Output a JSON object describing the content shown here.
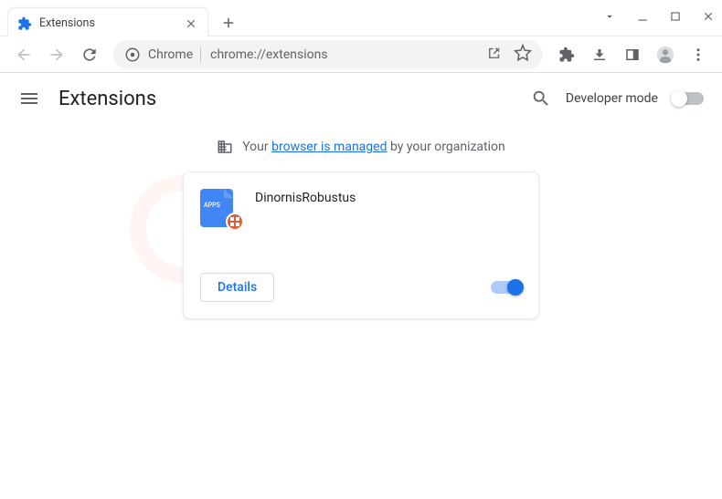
{
  "window": {
    "tab_title": "Extensions",
    "url": "chrome://extensions",
    "secure_label": "Chrome"
  },
  "header": {
    "title": "Extensions",
    "dev_mode_label": "Developer mode"
  },
  "notice": {
    "prefix": "Your ",
    "link": "browser is managed",
    "suffix": " by your organization"
  },
  "extension": {
    "name": "DinornisRobustus",
    "icon_text": "APPS",
    "details_label": "Details",
    "enabled": true
  }
}
